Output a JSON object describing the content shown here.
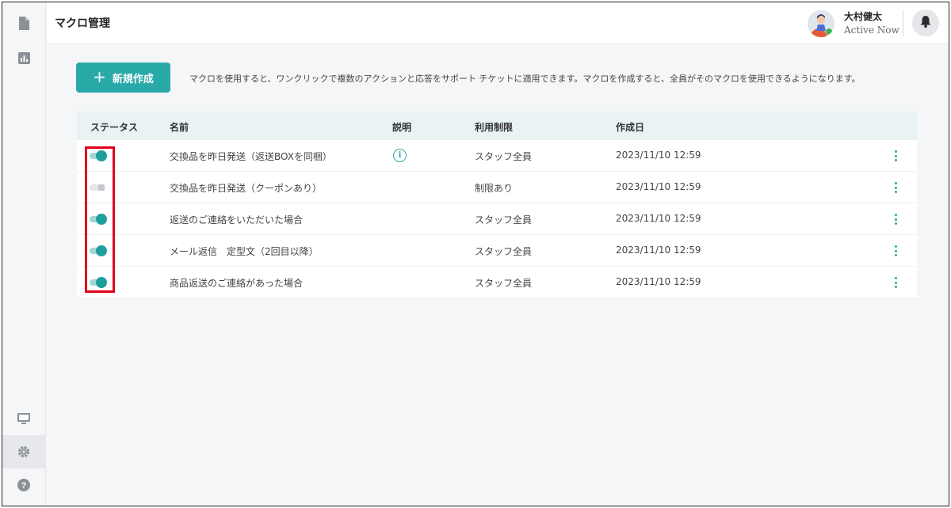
{
  "header": {
    "title": "マクロ管理",
    "user": {
      "name": "大村健太",
      "status": "Active Now"
    }
  },
  "toolbar": {
    "new_button_label": "新規作成",
    "description": "マクロを使用すると、ワンクリックで複数のアクションと応答をサポート チケットに適用できます。マクロを作成すると、全員がそのマクロを使用できるようになります。"
  },
  "table": {
    "columns": {
      "status": "ステータス",
      "name": "名前",
      "description": "説明",
      "limit": "利用制限",
      "created": "作成日"
    },
    "rows": [
      {
        "enabled": true,
        "name": "交換品を昨日発送（返送BOXを同梱）",
        "has_info": true,
        "limit": "スタッフ全員",
        "created": "2023/11/10 12:59"
      },
      {
        "enabled": false,
        "name": "交換品を昨日発送（クーポンあり）",
        "has_info": false,
        "limit": "制限あり",
        "created": "2023/11/10 12:59"
      },
      {
        "enabled": true,
        "name": "返送のご連絡をいただいた場合",
        "has_info": false,
        "limit": "スタッフ全員",
        "created": "2023/11/10 12:59"
      },
      {
        "enabled": true,
        "name": "メール返信　定型文（2回目以降）",
        "has_info": false,
        "limit": "スタッフ全員",
        "created": "2023/11/10 12:59"
      },
      {
        "enabled": true,
        "name": "商品返送のご連絡があった場合",
        "has_info": false,
        "limit": "スタッフ全員",
        "created": "2023/11/10 12:59"
      }
    ]
  },
  "icons": {
    "sidebar": [
      "document-icon",
      "chart-icon",
      "monitor-icon",
      "gear-icon",
      "help-icon"
    ],
    "accent_color": "#2aa9a9",
    "highlight_color": "#e0001a"
  }
}
